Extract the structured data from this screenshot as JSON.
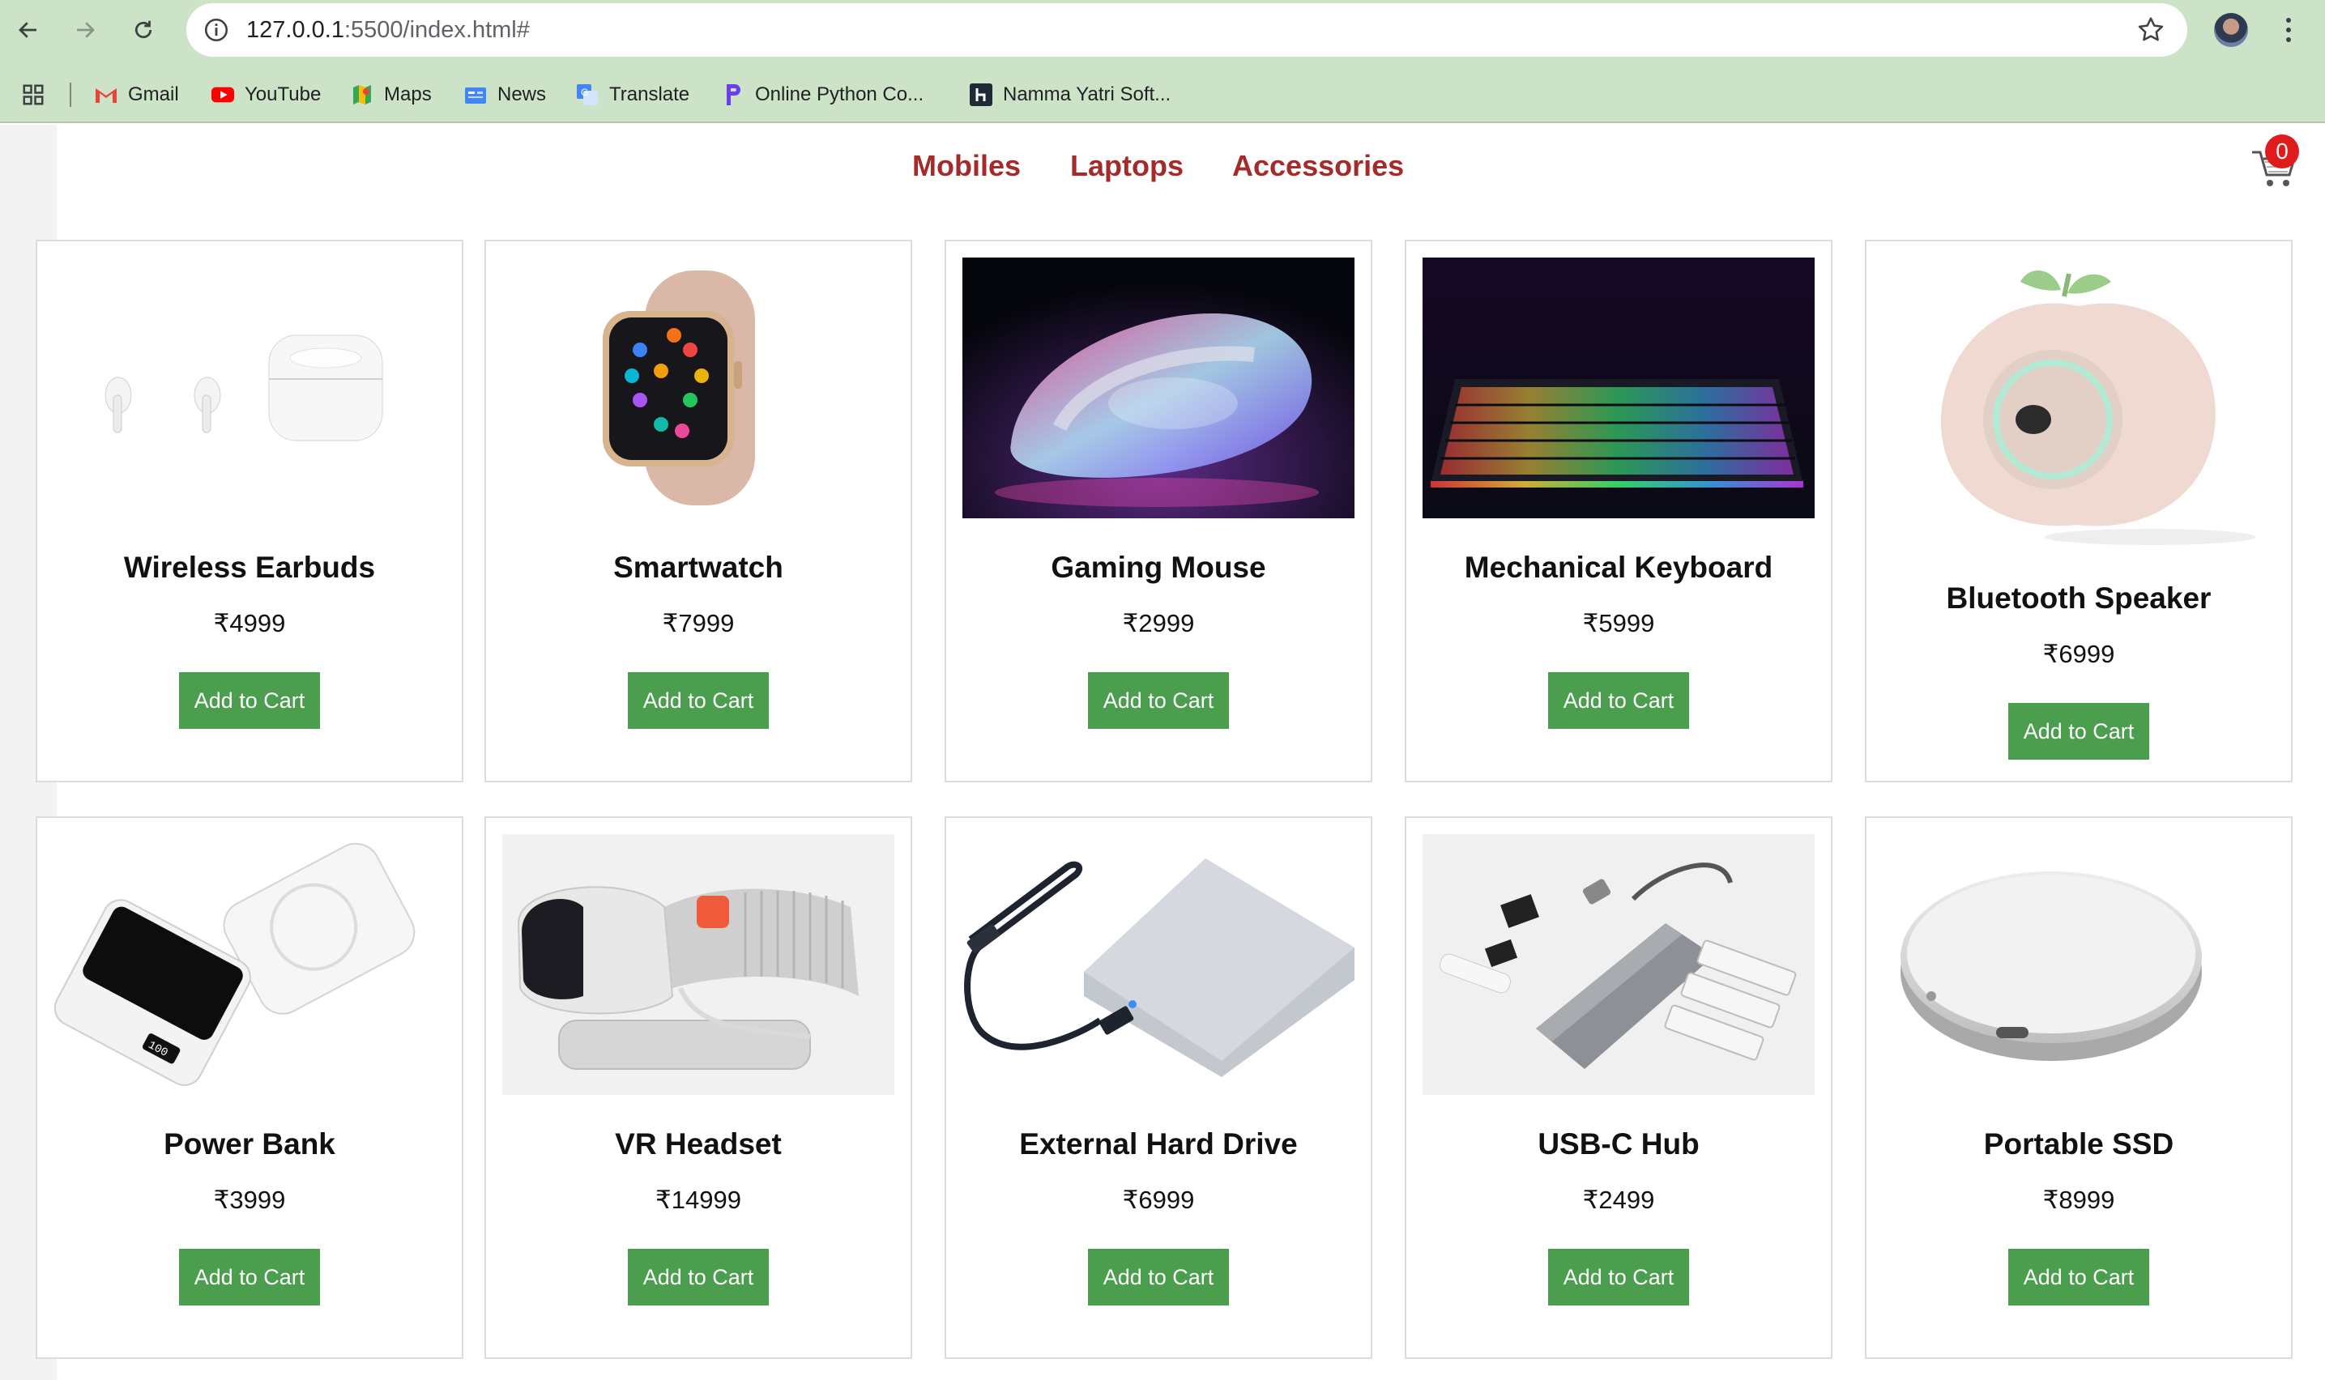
{
  "browser": {
    "url_host": "127.0.0.1",
    "url_rest": ":5500/index.html#",
    "bookmarks": [
      {
        "label": "Gmail",
        "icon": "gmail-icon"
      },
      {
        "label": "YouTube",
        "icon": "youtube-icon"
      },
      {
        "label": "Maps",
        "icon": "maps-icon"
      },
      {
        "label": "News",
        "icon": "news-icon"
      },
      {
        "label": "Translate",
        "icon": "translate-icon"
      },
      {
        "label": "Online Python Co...",
        "icon": "python-icon"
      },
      {
        "label": "Namma Yatri Soft...",
        "icon": "hackerrank-icon"
      }
    ]
  },
  "header": {
    "categories": [
      "Mobiles",
      "Laptops",
      "Accessories"
    ],
    "cart_count": "0"
  },
  "products": [
    {
      "name": "Wireless Earbuds",
      "price": "₹4999",
      "button": "Add to Cart"
    },
    {
      "name": "Smartwatch",
      "price": "₹7999",
      "button": "Add to Cart"
    },
    {
      "name": "Gaming Mouse",
      "price": "₹2999",
      "button": "Add to Cart"
    },
    {
      "name": "Mechanical Keyboard",
      "price": "₹5999",
      "button": "Add to Cart"
    },
    {
      "name": "Bluetooth Speaker",
      "price": "₹6999",
      "button": "Add to Cart"
    },
    {
      "name": "Power Bank",
      "price": "₹3999",
      "button": "Add to Cart"
    },
    {
      "name": "VR Headset",
      "price": "₹14999",
      "button": "Add to Cart"
    },
    {
      "name": "External Hard Drive",
      "price": "₹6999",
      "button": "Add to Cart"
    },
    {
      "name": "USB-C Hub",
      "price": "₹2499",
      "button": "Add to Cart"
    },
    {
      "name": "Portable SSD",
      "price": "₹8999",
      "button": "Add to Cart"
    }
  ],
  "colors": {
    "nav_link": "#a52a2a",
    "button": "#4a9e4e",
    "badge": "#e01b1b",
    "chrome": "#cde3c8"
  }
}
